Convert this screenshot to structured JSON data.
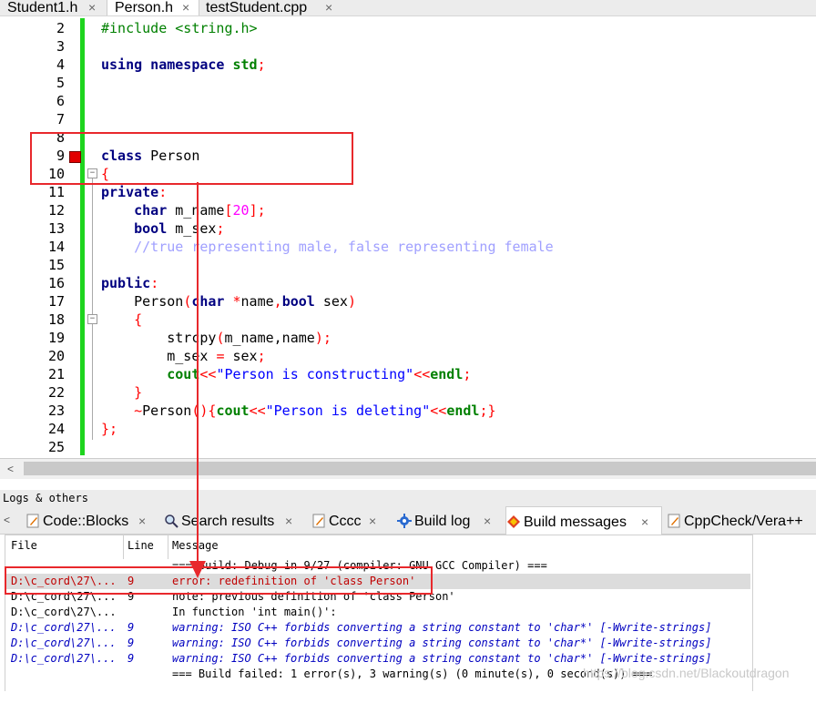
{
  "file_tabs": [
    {
      "label": "Student1.h",
      "active": false
    },
    {
      "label": "Person.h",
      "active": true
    },
    {
      "label": "testStudent.cpp",
      "active": false
    }
  ],
  "close_glyph": "×",
  "editor": {
    "line_numbers": [
      "2",
      "3",
      "4",
      "5",
      "6",
      "7",
      "8",
      "9",
      "10",
      "11",
      "12",
      "13",
      "14",
      "15",
      "16",
      "17",
      "18",
      "19",
      "20",
      "21",
      "22",
      "23",
      "24",
      "25"
    ],
    "code": {
      "l2": "#include <string.h>",
      "l4_kw": "using namespace",
      "l4_std": "std",
      "l4_end": ";",
      "l9_kw": "class",
      "l9_name": " Person",
      "l10": "{",
      "l11_kw": "private",
      "l11_colon": ":",
      "l12_kw": "char",
      "l12_name": " m_name",
      "l12_open": "[",
      "l12_num": "20",
      "l12_close": "];",
      "l13_kw": "bool",
      "l13_name": " m_sex",
      "l13_end": ";",
      "l14": "//true representing male, false representing female",
      "l16_kw": "public",
      "l16_colon": ":",
      "l17_name": "Person",
      "l17_p": "(",
      "l17_kw1": "char",
      "l17_star": " *",
      "l17_arg1": "name",
      "l17_comma": ",",
      "l17_kw2": "bool",
      "l17_arg2": " sex",
      "l17_close": ")",
      "l18": "{",
      "l19_fn": "strcpy",
      "l19_p": "(",
      "l19_args": "m_name,name",
      "l19_end": ");",
      "l20_a": "m_sex ",
      "l20_eq": "=",
      "l20_b": " sex",
      "l20_end": ";",
      "l21_kw": "cout",
      "l21_op": "<<",
      "l21_str": "\"Person is constructing\"",
      "l21_op2": "<<",
      "l21_kw2": "endl",
      "l21_end": ";",
      "l22": "}",
      "l23_tilde": "~",
      "l23_name": "Person",
      "l23_p": "(){",
      "l23_kw": "cout",
      "l23_op": "<<",
      "l23_str": "\"Person is deleting\"",
      "l23_op2": "<<",
      "l23_kw2": "endl",
      "l23_end": ";}",
      "l24": "};"
    }
  },
  "logs": {
    "title": "Logs & others",
    "tabs": [
      {
        "label": "Code::Blocks",
        "icon": "pencil-icon"
      },
      {
        "label": "Search results",
        "icon": "search-icon"
      },
      {
        "label": "Cccc",
        "icon": "pencil-icon"
      },
      {
        "label": "Build log",
        "icon": "gear-icon"
      },
      {
        "label": "Build messages",
        "icon": "diamond-icon",
        "active": true
      },
      {
        "label": "CppCheck/Vera++",
        "icon": "pencil-icon"
      }
    ],
    "columns": {
      "file": "File",
      "line": "Line",
      "message": "Message"
    },
    "rows": [
      {
        "file": "",
        "line": "",
        "message": "=== Build: Debug in 9/27 (compiler: GNU GCC Compiler) ===",
        "kind": "norm"
      },
      {
        "file": "D:\\c_cord\\27\\...",
        "line": "9",
        "message": "error: redefinition of 'class Person'",
        "kind": "err",
        "selected": true
      },
      {
        "file": "D:\\c_cord\\27\\...",
        "line": "9",
        "message": "note: previous definition of 'class Person'",
        "kind": "norm"
      },
      {
        "file": "D:\\c_cord\\27\\...",
        "line": "",
        "message": "In function 'int main()':",
        "kind": "norm"
      },
      {
        "file": "D:\\c_cord\\27\\...",
        "line": "9",
        "message": "warning: ISO C++ forbids converting a string constant to 'char*' [-Wwrite-strings]",
        "kind": "warn"
      },
      {
        "file": "D:\\c_cord\\27\\...",
        "line": "9",
        "message": "warning: ISO C++ forbids converting a string constant to 'char*' [-Wwrite-strings]",
        "kind": "warn"
      },
      {
        "file": "D:\\c_cord\\27\\...",
        "line": "9",
        "message": "warning: ISO C++ forbids converting a string constant to 'char*' [-Wwrite-strings]",
        "kind": "warn"
      },
      {
        "file": "",
        "line": "",
        "message": "=== Build failed: 1 error(s), 3 warning(s) (0 minute(s), 0 second(s)) ===",
        "kind": "norm"
      }
    ],
    "watermark": "https://blog.csdn.net/Blackoutdragon"
  },
  "colors": {
    "annotation": "#e8282c",
    "change_bar": "#1ed51e",
    "bookmark": "#e10000"
  }
}
